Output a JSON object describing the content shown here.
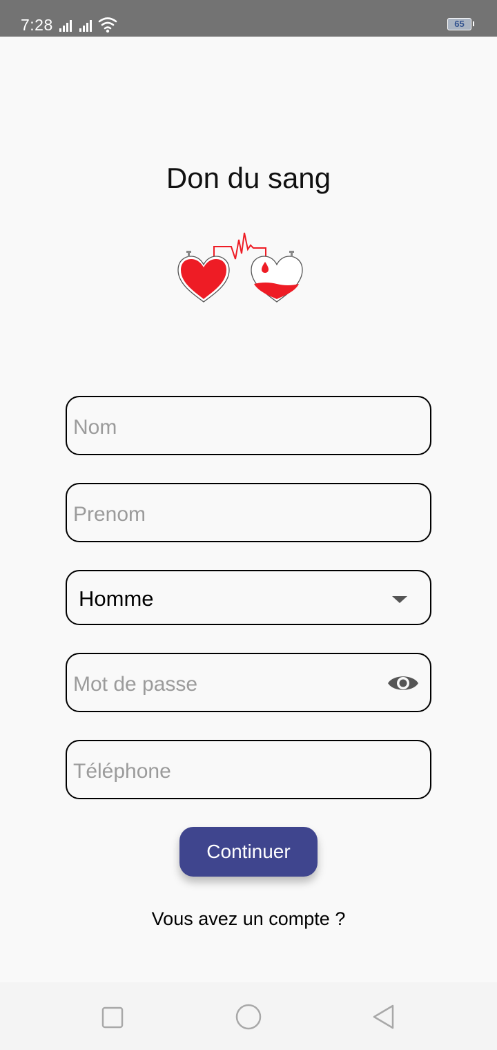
{
  "status_bar": {
    "time": "7:28",
    "battery_level": "65",
    "icons": [
      "signal-icon",
      "signal-icon",
      "wifi-icon",
      "battery-icon"
    ]
  },
  "app": {
    "title": "Don du sang",
    "logo_icon": "blood-donation-hearts-icon"
  },
  "form": {
    "nom_placeholder": "Nom",
    "prenom_placeholder": "Prenom",
    "gender_selected": "Homme",
    "password_placeholder": "Mot de passe",
    "phone_placeholder": "Téléphone"
  },
  "actions": {
    "continue_label": "Continuer",
    "have_account_label": "Vous avez un compte ?"
  },
  "nav_bar": {
    "icons": [
      "recent-apps-icon",
      "home-icon",
      "back-icon"
    ]
  },
  "colors": {
    "status_bar": "#737373",
    "background": "#f9f9f9",
    "primary_button": "#3f458e",
    "blood_red": "#ee1c25"
  }
}
